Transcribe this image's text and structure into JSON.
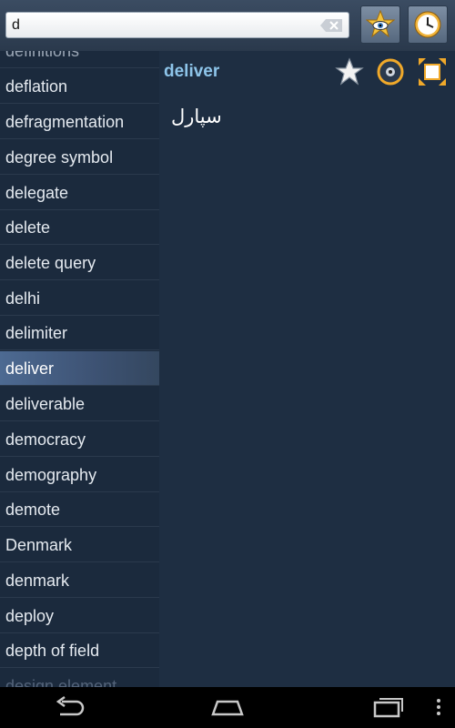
{
  "search": {
    "value": "d",
    "placeholder": ""
  },
  "toolbar": {
    "favorites_icon": "star-eye-icon",
    "history_icon": "clock-icon"
  },
  "word_list": {
    "top_partial": "definitions",
    "items": [
      "deflation",
      "defragmentation",
      "degree symbol",
      "delegate",
      "delete",
      "delete query",
      "delhi",
      "delimiter",
      "deliver",
      "deliverable",
      "democracy",
      "demography",
      "demote",
      "Denmark",
      "denmark",
      "deploy",
      "depth of field"
    ],
    "selected_index": 8,
    "bottom_partial": "design element"
  },
  "entry": {
    "headword": "deliver",
    "translation": "سپارل"
  },
  "colors": {
    "background": "#1b2a3d",
    "headword": "#8ec5ea",
    "selected": "#4d6a92"
  }
}
